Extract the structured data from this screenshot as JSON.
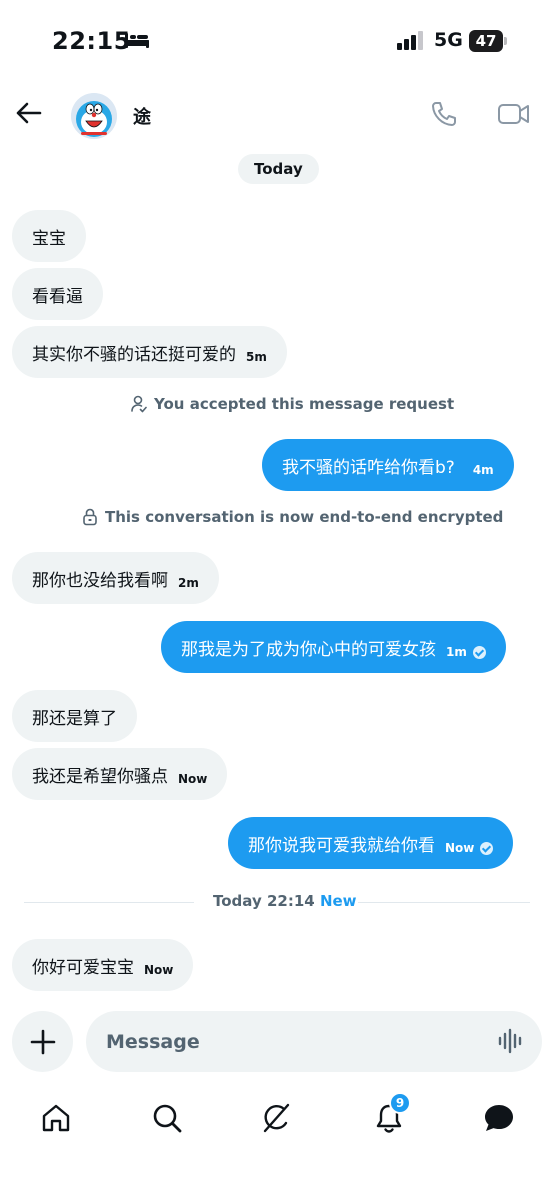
{
  "status_bar": {
    "time": "22:15",
    "network": "5G",
    "battery": "47"
  },
  "header": {
    "contact_name": "途"
  },
  "chat": {
    "date_label": "Today",
    "messages": [
      {
        "direction": "in",
        "text": "宝宝",
        "time": ""
      },
      {
        "direction": "in",
        "text": "看看逼",
        "time": ""
      },
      {
        "direction": "in",
        "text": "其实你不骚的话还挺可爱的",
        "time": "5m"
      },
      {
        "direction": "out",
        "text": "我不骚的话咋给你看b?",
        "time": "4m"
      },
      {
        "direction": "in",
        "text": "那你也没给我看啊",
        "time": "2m"
      },
      {
        "direction": "out",
        "text": "那我是为了成为你心中的可爱女孩",
        "time": "1m"
      },
      {
        "direction": "in",
        "text": "那还是算了",
        "time": ""
      },
      {
        "direction": "in",
        "text": "我还是希望你骚点",
        "time": "Now"
      },
      {
        "direction": "out",
        "text": "那你说我可爱我就给你看",
        "time": "Now"
      },
      {
        "direction": "in",
        "text": "你好可爱宝宝",
        "time": "Now"
      }
    ],
    "system_notes": {
      "accepted": "You accepted this message request",
      "encrypted": "This conversation is now end-to-end encrypted"
    },
    "divider": {
      "label": "Today 22:14",
      "new_label": "New"
    }
  },
  "composer": {
    "placeholder": "Message"
  },
  "tab_bar": {
    "items": [
      "home-icon",
      "search-icon",
      "grok-icon",
      "notifications-icon",
      "messages-icon"
    ],
    "notifications_badge": "9"
  },
  "colors": {
    "accent": "#1d9bf0",
    "incoming_bubble": "#eff3f4",
    "muted_text": "#536471"
  }
}
